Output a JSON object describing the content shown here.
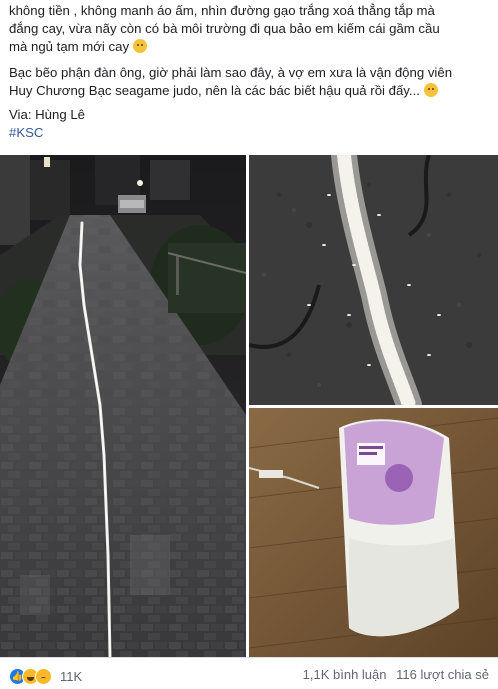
{
  "post": {
    "line1": "không tiền , không manh áo ấm, nhìn đường gạo trắng xoá thẳng tắp mà",
    "line2": "đắng cay, vừa nãy còn có bà môi trường đi qua bảo em kiếm cái gầm cầu",
    "line3": "mà ngủ tạm mới cay",
    "line4": "Bạc bẽo phận đàn ông, giờ phải làm sao đây, à vợ em xưa là vận động viên",
    "line5": "Huy Chương Bạc seagame judo, nên là các bác biết hậu quả rồi đấy...",
    "via": "Via: Hùng Lê",
    "hashtag": "#KSC"
  },
  "footer": {
    "reaction_count": "11K",
    "comments": "1,1K bình luận",
    "shares": "116 lượt chia sẻ"
  },
  "reactions": [
    "like-icon",
    "haha-icon",
    "sad-icon"
  ]
}
